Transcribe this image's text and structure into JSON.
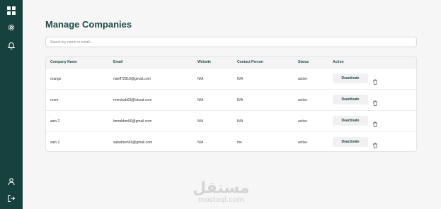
{
  "sidebar": {
    "items": [
      {
        "icon": "dashboard-icon"
      },
      {
        "icon": "gear-icon"
      },
      {
        "icon": "bell-icon"
      },
      {
        "icon": "user-icon"
      },
      {
        "icon": "logout-icon"
      }
    ]
  },
  "page": {
    "title": "Manage Companies"
  },
  "search": {
    "placeholder": "Search by name or email...",
    "value": ""
  },
  "table": {
    "columns": [
      "Company Name",
      "Email",
      "Website",
      "Contact Person",
      "Status",
      "Action"
    ],
    "rows": [
      {
        "company": "orange",
        "email": "naeff72919@gmail.com",
        "website": "N/A",
        "contact": "N/A",
        "status": "active",
        "action": "Deactivate"
      },
      {
        "company": "reem",
        "email": "reemhab03@icloud.com",
        "website": "N/A",
        "contact": "N/A",
        "status": "active",
        "action": "Deactivate"
      },
      {
        "company": "zain 2",
        "email": "bmmbbm66@gmail.com",
        "website": "N/A",
        "contact": "N/A",
        "status": "active",
        "action": "Deactivate"
      },
      {
        "company": "zain 2",
        "email": "sababseh66@gmail.com",
        "website": "N/A",
        "contact": "me",
        "status": "active",
        "action": "Deactivate"
      }
    ]
  },
  "watermark": {
    "arabic": "مستقل",
    "latin": "mostaql.com"
  },
  "colors": {
    "sidebar": "#17413f",
    "title": "#1f4a47",
    "background": "#f6f6f6"
  }
}
